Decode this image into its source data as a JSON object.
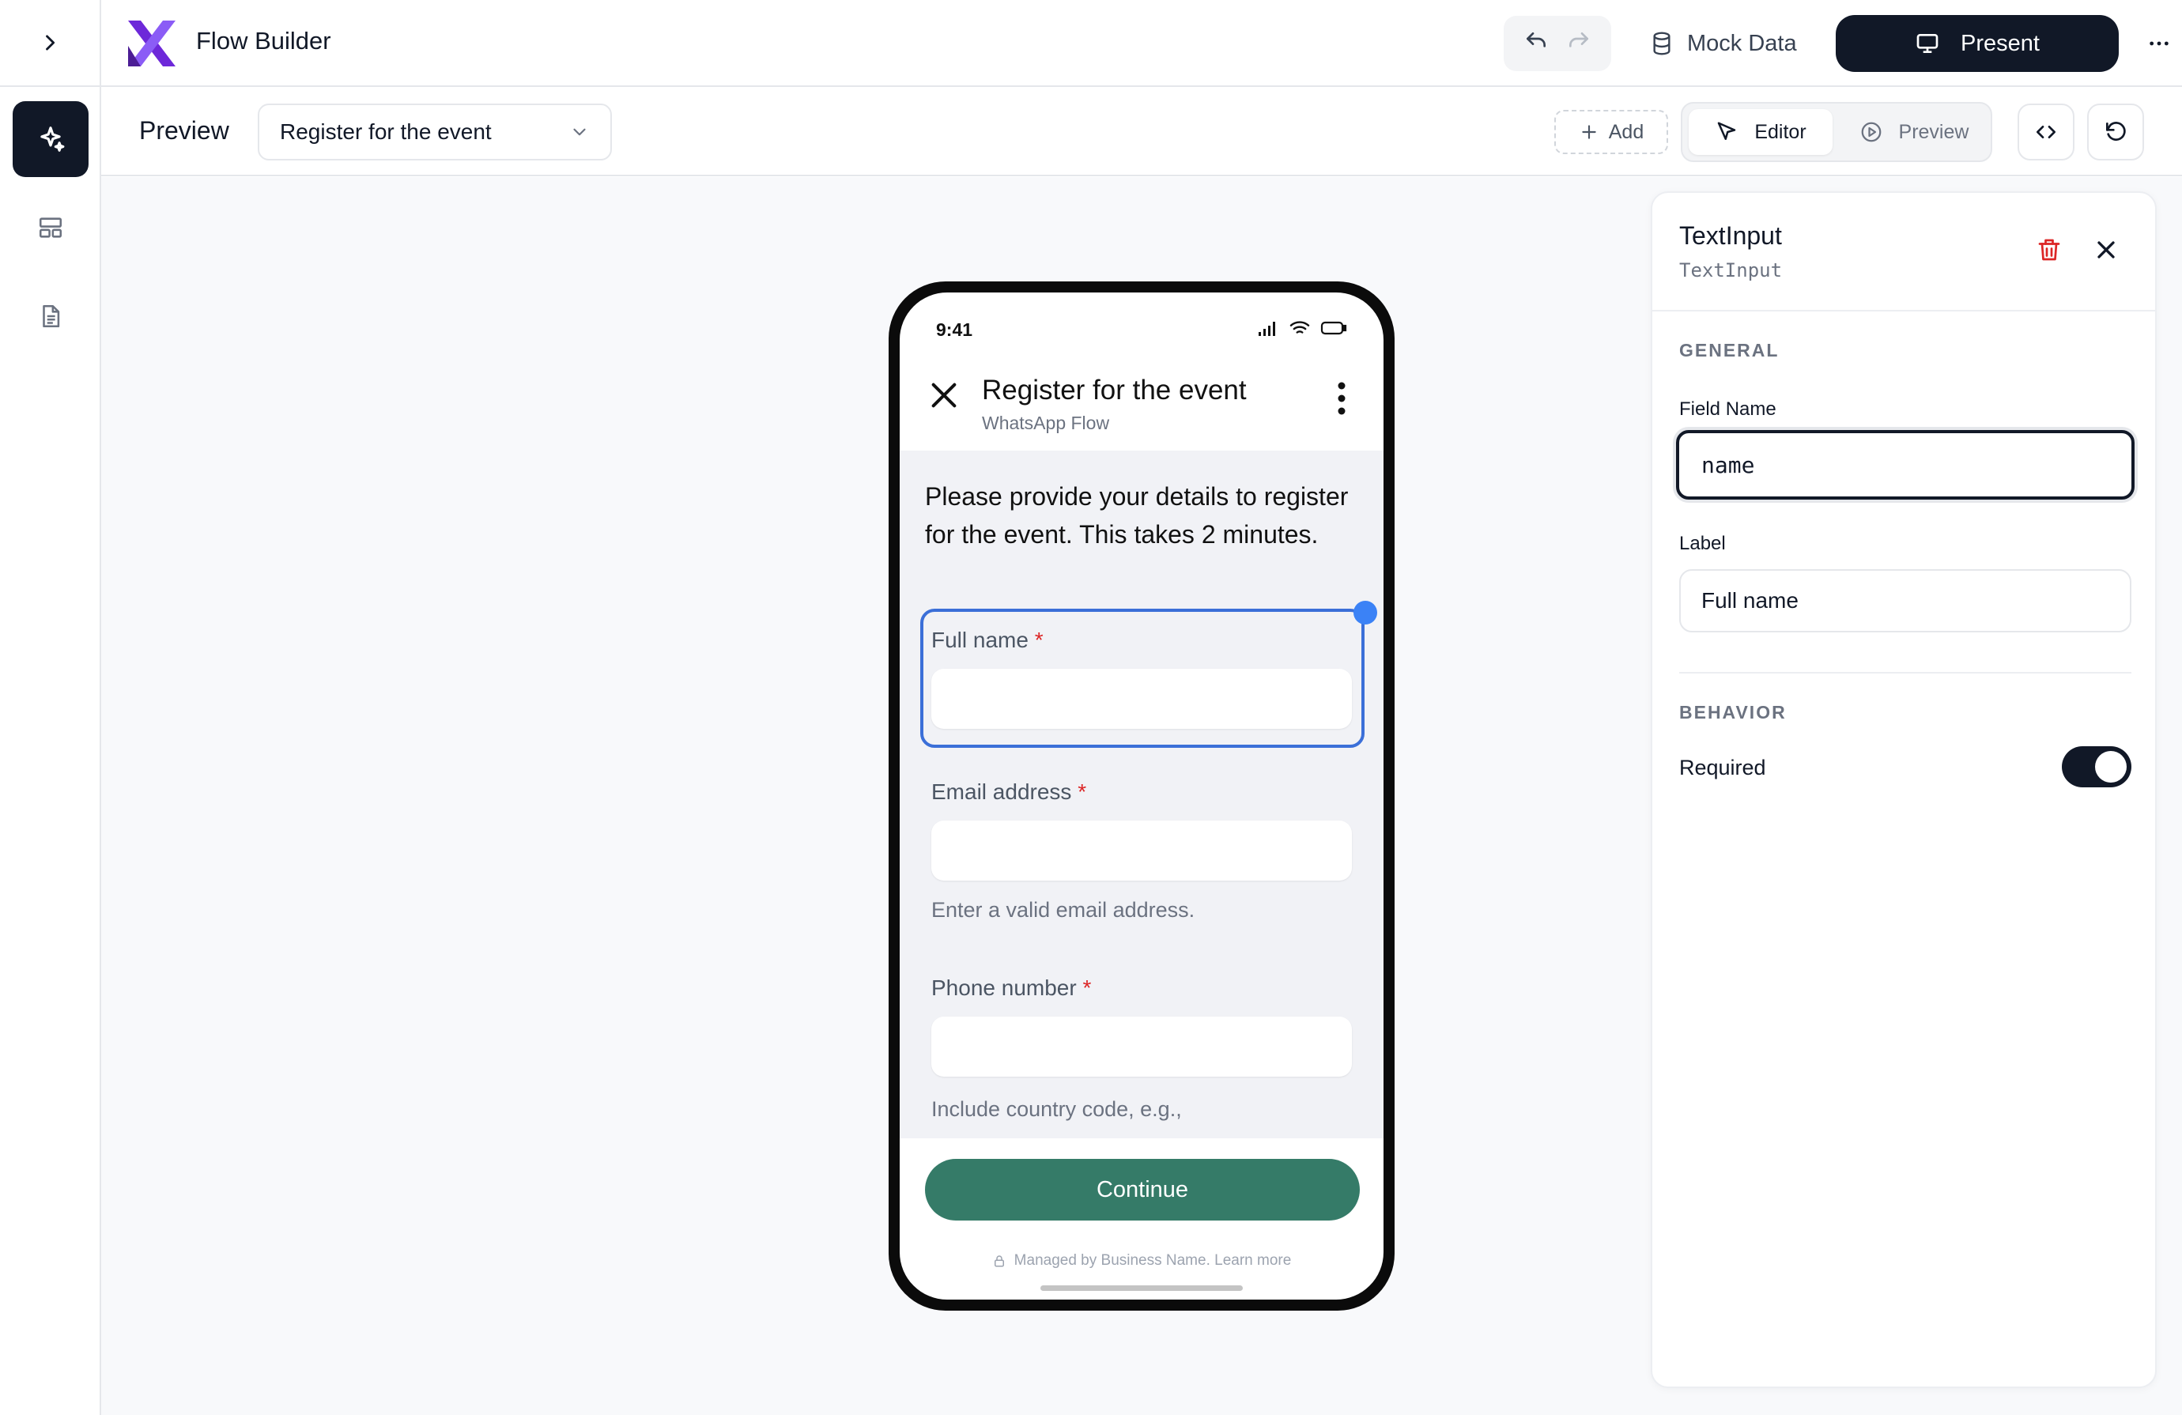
{
  "app": {
    "title": "Flow Builder"
  },
  "topbar": {
    "mock_label": "Mock Data",
    "present_label": "Present"
  },
  "toolbar": {
    "title": "Preview",
    "screen_select": "Register for the event",
    "add_label": "Add",
    "editor_label": "Editor",
    "preview_label": "Preview"
  },
  "phone": {
    "time": "9:41",
    "title": "Register for the event",
    "subtitle": "WhatsApp Flow",
    "intro": "Please provide your details to register for the event. This takes 2 minutes.",
    "fields": [
      {
        "label": "Full name",
        "required": "*",
        "value": "",
        "help": ""
      },
      {
        "label": "Email address",
        "required": "*",
        "value": "",
        "help": "Enter a valid email address."
      },
      {
        "label": "Phone number",
        "required": "*",
        "value": "",
        "help": "Include country code, e.g.,"
      }
    ],
    "continue_label": "Continue",
    "managed_text": "Managed by Business Name. Learn more"
  },
  "panel": {
    "title": "TextInput",
    "subtitle": "TextInput",
    "general_heading": "GENERAL",
    "field_name_label": "Field Name",
    "field_name_value": "name",
    "label_label": "Label",
    "label_value": "Full name",
    "behavior_heading": "BEHAVIOR",
    "required_label": "Required",
    "required_on": true
  },
  "colors": {
    "accent_dark": "#111827",
    "flow_button": "#357b68",
    "selection": "#3b6fd8",
    "logo_purple": "#6d28d9",
    "required_star": "#dc2626"
  }
}
